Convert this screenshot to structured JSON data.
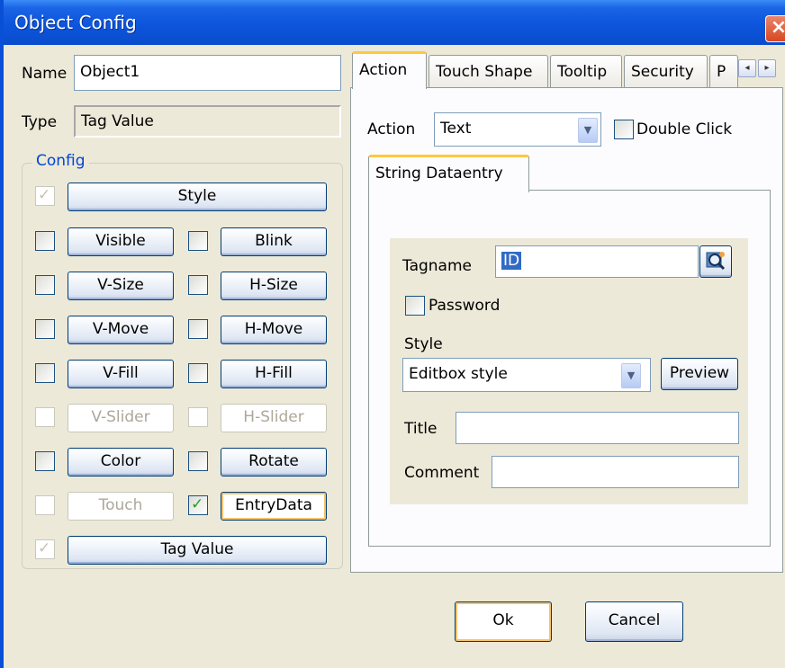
{
  "window": {
    "title": "Object Config",
    "close_glyph": "×"
  },
  "name_field": {
    "label": "Name",
    "value": "Object1"
  },
  "type_field": {
    "label": "Type",
    "value": "Tag Value"
  },
  "config": {
    "legend": "Config",
    "style_button": "Style",
    "tag_value_button": "Tag Value",
    "rows": [
      [
        {
          "label": "Visible",
          "checked": false,
          "enabled": true
        },
        {
          "label": "Blink",
          "checked": false,
          "enabled": true
        }
      ],
      [
        {
          "label": "V-Size",
          "checked": false,
          "enabled": true
        },
        {
          "label": "H-Size",
          "checked": false,
          "enabled": true
        }
      ],
      [
        {
          "label": "V-Move",
          "checked": false,
          "enabled": true
        },
        {
          "label": "H-Move",
          "checked": false,
          "enabled": true
        }
      ],
      [
        {
          "label": "V-Fill",
          "checked": false,
          "enabled": true
        },
        {
          "label": "H-Fill",
          "checked": false,
          "enabled": true
        }
      ],
      [
        {
          "label": "V-Slider",
          "checked": false,
          "enabled": false
        },
        {
          "label": "H-Slider",
          "checked": false,
          "enabled": false
        }
      ],
      [
        {
          "label": "Color",
          "checked": false,
          "enabled": true
        },
        {
          "label": "Rotate",
          "checked": false,
          "enabled": true
        }
      ],
      [
        {
          "label": "Touch",
          "checked": false,
          "enabled": false
        },
        {
          "label": "EntryData",
          "checked": true,
          "enabled": true
        }
      ]
    ]
  },
  "tabs": {
    "items": [
      "Action",
      "Touch Shape",
      "Tooltip",
      "Security",
      "P"
    ],
    "active": "Action",
    "scroll_left": "◂",
    "scroll_right": "▸"
  },
  "action": {
    "label": "Action",
    "selected": "Text",
    "double_click_label": "Double Click",
    "double_click_checked": false
  },
  "subtab": {
    "label": "String Dataentry",
    "tagname_label": "Tagname",
    "tagname_value": "ID",
    "password_label": "Password",
    "password_checked": false,
    "style_label": "Style",
    "style_selected": "Editbox style",
    "preview_button": "Preview",
    "title_label": "Title",
    "title_value": "",
    "comment_label": "Comment",
    "comment_value": ""
  },
  "footer": {
    "ok": "Ok",
    "cancel": "Cancel"
  },
  "check_glyph": "✓",
  "colors": {
    "titlebar": "#0d55dc",
    "accent_tab": "#ffc83c",
    "group_legend": "#0046d5",
    "close": "#d9471f"
  }
}
